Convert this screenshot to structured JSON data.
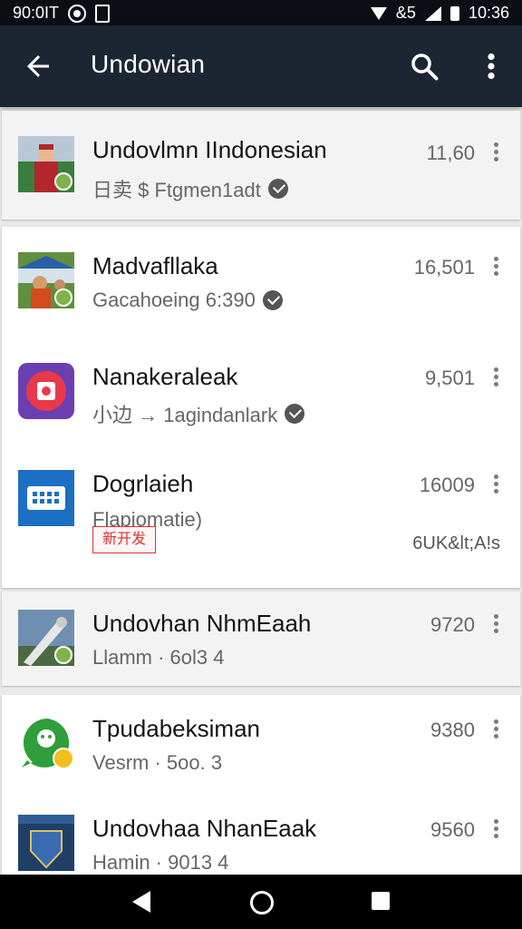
{
  "statusbar": {
    "left_text": "90:0IT",
    "time": "10:36",
    "carrier": "&5"
  },
  "appbar": {
    "title": "Undowian",
    "background": "#1c2632"
  },
  "items": [
    {
      "name": "Undovlmn IIndonesian",
      "sub_text": "日卖 $ Ftgmen1adt",
      "count": "11,60"
    },
    {
      "name": "Madvafllaka",
      "sub_text": "Gacahoeing 6:390",
      "count": "16,501"
    },
    {
      "name": "Nanakeraleak",
      "sub_text": "小边 → 1agindanlark",
      "count": "9,501"
    },
    {
      "name": "Dogrlaieh",
      "sub_text": "Flapiomatie)",
      "count": "16009",
      "tag": "新开发",
      "size": "6UK&lt;A!s"
    },
    {
      "name": "Undovhan NhmEaah",
      "sub_text": "Llamm · 6ol3 4",
      "count": "9720"
    },
    {
      "name": "Tpudabeksiman",
      "sub_text": "Vesrm · 5oo. 3",
      "count": "9380"
    },
    {
      "name": "Undovhaa NhanEaak",
      "sub_text": "Hamin · 9013 4",
      "count": "9560"
    }
  ]
}
